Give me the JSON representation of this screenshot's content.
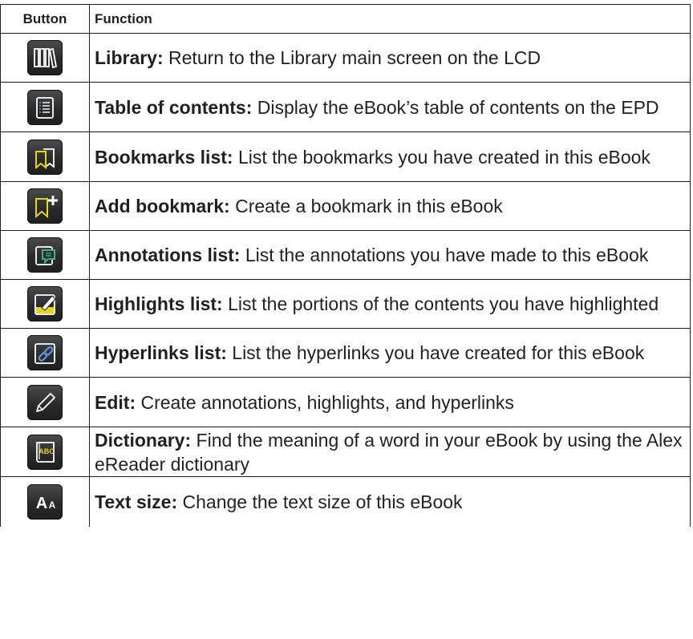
{
  "header": {
    "col_button": "Button",
    "col_function": "Function"
  },
  "rows": [
    {
      "icon": "library-icon",
      "term": "Library:",
      "text": " Return to the Library main screen on the LCD"
    },
    {
      "icon": "table-of-contents-icon",
      "term": "Table of contents:",
      "text": " Display the eBook’s table of contents on the EPD"
    },
    {
      "icon": "bookmarks-list-icon",
      "term": "Bookmarks list:",
      "text": " List the bookmarks you have created in this eBook"
    },
    {
      "icon": "add-bookmark-icon",
      "term": "Add bookmark:",
      "text": " Create a bookmark in this eBook"
    },
    {
      "icon": "annotations-list-icon",
      "term": "Annotations list:",
      "text": " List the annotations you have made to this eBook"
    },
    {
      "icon": "highlights-list-icon",
      "term": "Highlights list:",
      "text": " List the portions of the contents you have highlighted"
    },
    {
      "icon": "hyperlinks-list-icon",
      "term": "Hyperlinks list:",
      "text": " List the hyperlinks you have created for this eBook"
    },
    {
      "icon": "edit-pencil-icon",
      "term": "Edit:",
      "text": " Create annotations, highlights, and hyperlinks"
    },
    {
      "icon": "dictionary-icon",
      "term": "Dictionary:",
      "text": " Find the meaning of a word in your eBook by using the Alex eReader dictionary",
      "icon_text": "ABC"
    },
    {
      "icon": "text-size-icon",
      "term": "Text size:",
      "text": " Change the text size of this eBook",
      "icon_text_big": "A",
      "icon_text_small": "A"
    }
  ],
  "colors": {
    "icon_yellow": "#e8d21a",
    "icon_blue": "#5b8fd0",
    "icon_green": "#3fae8a",
    "border": "#231f20"
  }
}
